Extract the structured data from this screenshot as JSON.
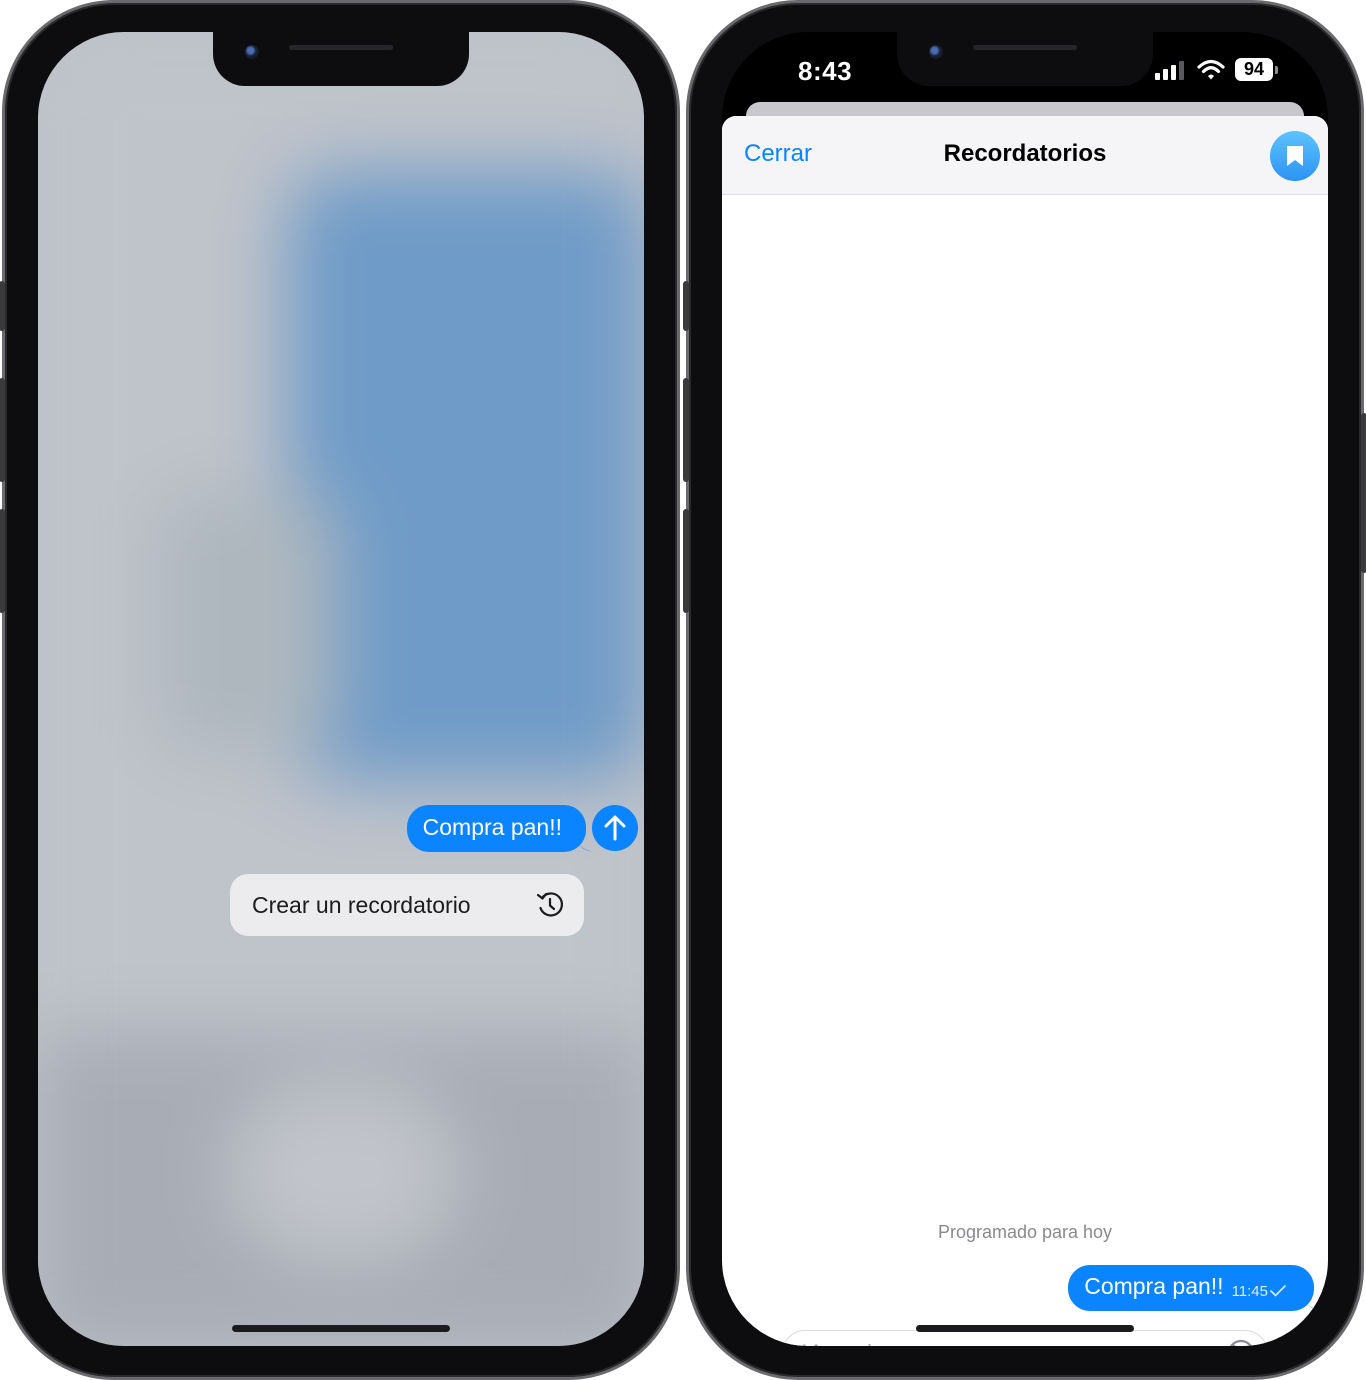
{
  "left_phone": {
    "message_bubble": "Compra pan!!",
    "menu_item_label": "Crear un recordatorio",
    "send_icon": "arrow-up-icon",
    "menu_icon": "clock-reminder-icon"
  },
  "right_phone": {
    "status_bar": {
      "time": "8:43",
      "battery": "94"
    },
    "header": {
      "close_label": "Cerrar",
      "title": "Recordatorios",
      "action_icon": "bookmark-icon"
    },
    "schedule_label": "Programado para hoy",
    "message": {
      "text": "Compra pan!!",
      "time": "11:45"
    },
    "composer": {
      "placeholder": "Mensaje",
      "value": ""
    }
  },
  "colors": {
    "accent": "#0a84ff",
    "menu_background": "#ececef",
    "sheet_header": "#f5f5f7"
  }
}
